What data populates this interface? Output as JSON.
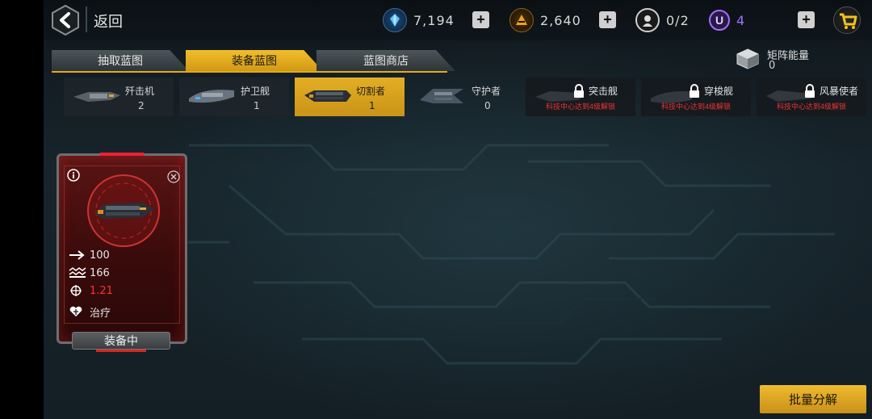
{
  "header": {
    "back_label": "返回",
    "resources": [
      {
        "name": "crystal",
        "value": "7,194",
        "color": "#3aa8ff"
      },
      {
        "name": "alloy",
        "value": "2,640",
        "color": "#f0a020"
      },
      {
        "name": "pilot",
        "value": "0/2",
        "color": "#d8d8d8"
      },
      {
        "name": "u-currency",
        "value": "4",
        "color": "#a070ff"
      }
    ],
    "plus_symbol": "+"
  },
  "tabs": [
    {
      "label": "抽取蓝图",
      "active": false
    },
    {
      "label": "装备蓝图",
      "active": true
    },
    {
      "label": "蓝图商店",
      "active": false
    }
  ],
  "matrix_energy": {
    "label": "矩阵能量",
    "value": "0"
  },
  "ship_filters": [
    {
      "name": "歼击机",
      "count": "2",
      "state": "normal"
    },
    {
      "name": "护卫舰",
      "count": "1",
      "state": "normal"
    },
    {
      "name": "切割者",
      "count": "1",
      "state": "active"
    },
    {
      "name": "守护者",
      "count": "0",
      "state": "normal"
    },
    {
      "name": "突击舰",
      "requirement": "科技中心达到4级解锁",
      "state": "locked"
    },
    {
      "name": "穿梭舰",
      "requirement": "科技中心达到4级解锁",
      "state": "locked"
    },
    {
      "name": "风暴使者",
      "requirement": "科技中心达到4级解锁",
      "state": "locked"
    }
  ],
  "card": {
    "stats": [
      {
        "icon": "speed-arrow-icon",
        "value": "100"
      },
      {
        "icon": "damage-waves-icon",
        "value": "166"
      },
      {
        "icon": "crosshair-icon",
        "value": "1.21",
        "color": "#ff3333"
      },
      {
        "icon": "heart-repair-icon",
        "value": "治疗"
      }
    ],
    "status_label": "装备中"
  },
  "batch_button": "批量分解"
}
